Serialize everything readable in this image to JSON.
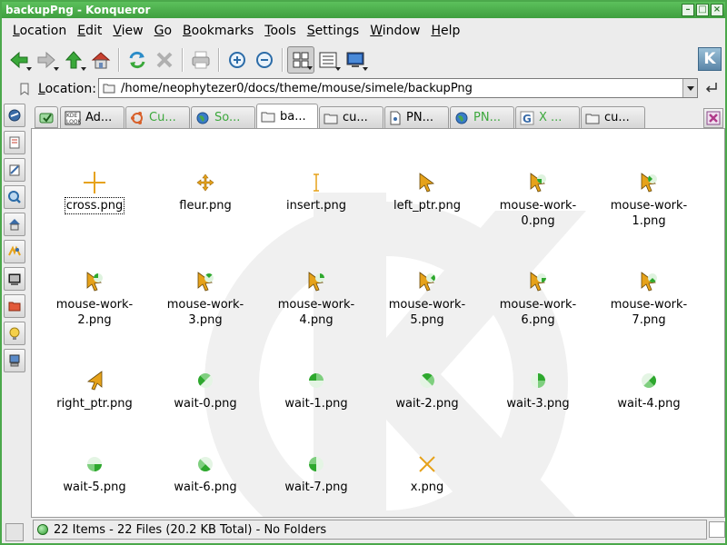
{
  "window": {
    "title": "backupPng - Konqueror"
  },
  "menu": [
    {
      "pre": "",
      "u": "L",
      "post": "ocation"
    },
    {
      "pre": "",
      "u": "E",
      "post": "dit"
    },
    {
      "pre": "",
      "u": "V",
      "post": "iew"
    },
    {
      "pre": "",
      "u": "G",
      "post": "o"
    },
    {
      "pre": "",
      "u": "B",
      "post": "ookmarks"
    },
    {
      "pre": "",
      "u": "T",
      "post": "ools"
    },
    {
      "pre": "",
      "u": "S",
      "post": "ettings"
    },
    {
      "pre": "",
      "u": "W",
      "post": "indow"
    },
    {
      "pre": "",
      "u": "H",
      "post": "elp"
    }
  ],
  "location": {
    "label_u": "L",
    "label_rest": "ocation:",
    "value": "/home/neophytezer0/docs/theme/mouse/simele/backupPng"
  },
  "tabs": [
    {
      "label": "Ad...",
      "green": false
    },
    {
      "label": "Cu...",
      "green": true
    },
    {
      "label": "So...",
      "green": true
    },
    {
      "label": "ba...",
      "green": false
    },
    {
      "label": "cu...",
      "green": false
    },
    {
      "label": "PN...",
      "green": false
    },
    {
      "label": "PN...",
      "green": true
    },
    {
      "label": "X ...",
      "green": true
    },
    {
      "label": "cu...",
      "green": false
    }
  ],
  "files": [
    {
      "name": "cross.png",
      "icon": "cross-icon"
    },
    {
      "name": "fleur.png",
      "icon": "fleur-icon"
    },
    {
      "name": "insert.png",
      "icon": "ibeam-icon"
    },
    {
      "name": "left_ptr.png",
      "icon": "arrow-icon"
    },
    {
      "name": "mouse-work-0.png",
      "icon": "busy-arrow-icon"
    },
    {
      "name": "mouse-work-1.png",
      "icon": "busy-arrow-icon"
    },
    {
      "name": "mouse-work-2.png",
      "icon": "busy-arrow-icon"
    },
    {
      "name": "mouse-work-3.png",
      "icon": "busy-arrow-icon"
    },
    {
      "name": "mouse-work-4.png",
      "icon": "busy-arrow-icon"
    },
    {
      "name": "mouse-work-5.png",
      "icon": "busy-arrow-icon"
    },
    {
      "name": "mouse-work-6.png",
      "icon": "busy-arrow-icon"
    },
    {
      "name": "mouse-work-7.png",
      "icon": "busy-arrow-icon"
    },
    {
      "name": "right_ptr.png",
      "icon": "right-arrow-icon"
    },
    {
      "name": "wait-0.png",
      "icon": "wait-icon"
    },
    {
      "name": "wait-1.png",
      "icon": "wait-icon"
    },
    {
      "name": "wait-2.png",
      "icon": "wait-icon"
    },
    {
      "name": "wait-3.png",
      "icon": "wait-icon"
    },
    {
      "name": "wait-4.png",
      "icon": "wait-icon"
    },
    {
      "name": "wait-5.png",
      "icon": "wait-icon"
    },
    {
      "name": "wait-6.png",
      "icon": "wait-icon"
    },
    {
      "name": "wait-7.png",
      "icon": "wait-icon"
    },
    {
      "name": "x.png",
      "icon": "x-cursor-icon"
    }
  ],
  "status": {
    "text": "22 Items - 22 Files (20.2 KB Total) - No Folders"
  },
  "colors": {
    "accent": "#4ba84b",
    "cursor": "#e6a21a",
    "wait": "#2ea82e"
  }
}
